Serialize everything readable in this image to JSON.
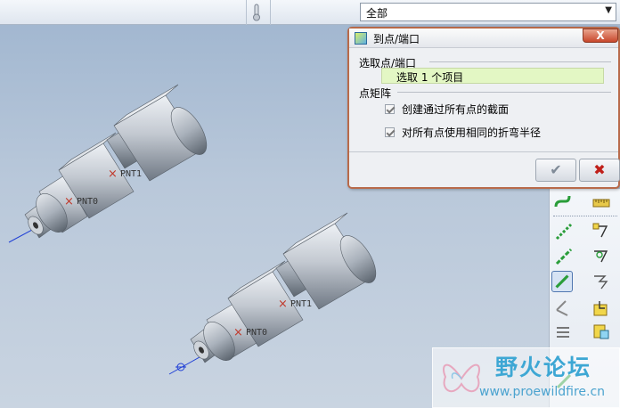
{
  "toolbar": {
    "filter_value": "全部"
  },
  "viewport": {
    "part_upper": {
      "datum_points": [
        "PNT0",
        "PNT1"
      ]
    },
    "part_lower": {
      "datum_points": [
        "PNT0",
        "PNT1"
      ]
    }
  },
  "dialog": {
    "title": "到点/端口",
    "close_label": "X",
    "pick_section_label": "选取点/端口",
    "pick_value": "选取 1 个项目",
    "array_section_label": "点矩阵",
    "options": [
      {
        "label": "创建通过所有点的截面",
        "checked": true
      },
      {
        "label": "对所有点使用相同的折弯半径",
        "checked": true
      }
    ],
    "ok_icon": "checkmark-icon",
    "cancel_icon": "red-x-icon"
  },
  "watermark": {
    "title": "野火论坛",
    "url": "www.proewildfire.cn"
  },
  "colors": {
    "viewport_top": "#9fb5cf",
    "viewport_bottom": "#c9d4e1",
    "dialog_border": "#b86a4a",
    "pick_field_bg": "#e3f7c4",
    "datum_point": "#c0392b",
    "axis_line": "#1f3fd6",
    "cancel_red": "#c0201a"
  }
}
